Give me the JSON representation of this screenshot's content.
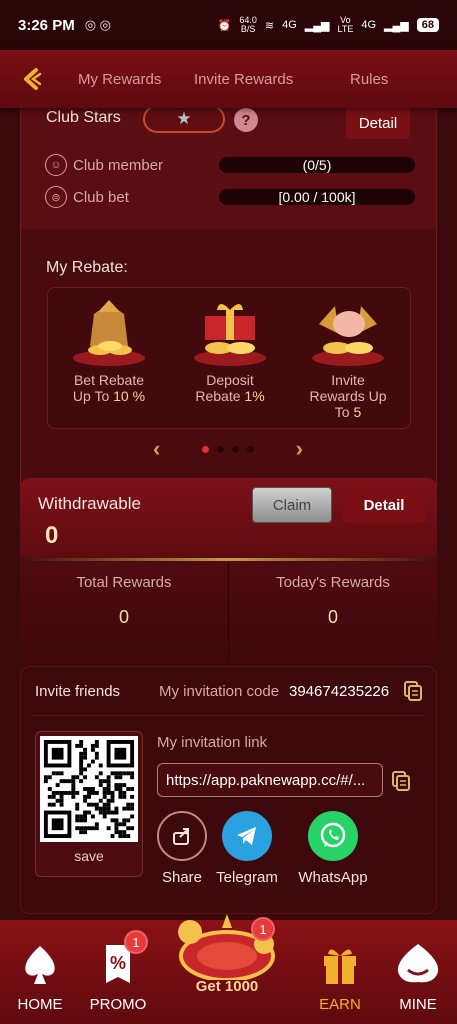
{
  "status_bar": {
    "time": "3:26 PM",
    "speed_value": "64.0",
    "speed_unit": "B/S",
    "net1": "4G",
    "net2_top": "Vo",
    "net2_bottom": "LTE",
    "net3": "4G",
    "battery": "68"
  },
  "nav": {
    "tabs": [
      {
        "label": "My Rewards"
      },
      {
        "label": "Invite Rewards"
      },
      {
        "label": "Rules"
      }
    ]
  },
  "club": {
    "stars_label": "Club Stars",
    "star_glyph": "★",
    "help_glyph": "?",
    "detail_label": "Detail",
    "member_label": "Club member",
    "member_value": "(0/5)",
    "bet_label": "Club bet",
    "bet_value": "[0.00 / 100k]"
  },
  "rebate": {
    "title": "My Rebate:",
    "items": [
      {
        "line1": "Bet Rebate",
        "line2_prefix": "Up To ",
        "line2_value": "10 %"
      },
      {
        "line1": "Deposit",
        "line2_prefix": "Rebate ",
        "line2_value": "1%"
      },
      {
        "line1": "Invite",
        "line2_prefix": "Rewards Up",
        "line3_prefix": "To ",
        "line3_value": "5"
      }
    ],
    "pager": {
      "prev": "‹",
      "next": "›",
      "page_count": 4,
      "active_index": 0
    }
  },
  "withdraw": {
    "label": "Withdrawable",
    "value": "0",
    "claim_label": "Claim",
    "detail_label": "Detail"
  },
  "rewards": {
    "total_label": "Total Rewards",
    "total_value": "0",
    "today_label": "Today's Rewards",
    "today_value": "0"
  },
  "invite": {
    "title": "Invite friends",
    "code_label": "My invitation code",
    "code": "394674235226",
    "link_label": "My invitation link",
    "link": "https://app.paknewapp.cc/#/...",
    "save_label": "save",
    "share_options": [
      {
        "label": "Share",
        "icon": "share-icon"
      },
      {
        "label": "Telegram",
        "icon": "telegram-icon"
      },
      {
        "label": "WhatsApp",
        "icon": "whatsapp-icon"
      }
    ]
  },
  "bottom_nav": {
    "home_label": "HOME",
    "promo_label": "PROMO",
    "promo_badge": "1",
    "center_label": "Get 1000",
    "center_badge": "1",
    "earn_label": "EARN",
    "mine_label": "MINE"
  },
  "colors": {
    "background": "#3a0a0c",
    "header": "#7a0f14",
    "accent_gold": "#f1b12e",
    "badge_red": "#e73b3b"
  }
}
